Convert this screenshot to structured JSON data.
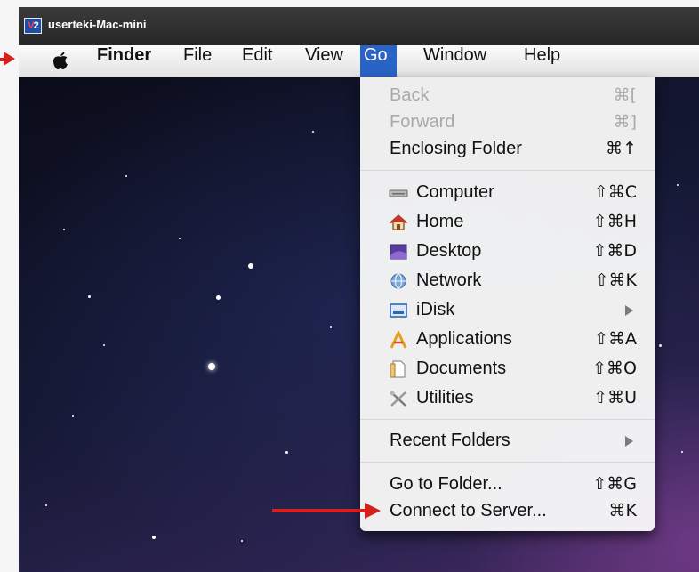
{
  "window": {
    "logo_text": "V2",
    "hostname": "userteki-Mac-mini"
  },
  "menubar": {
    "apple_icon": "apple-logo-icon",
    "items": [
      {
        "label": "Finder"
      },
      {
        "label": "File"
      },
      {
        "label": "Edit"
      },
      {
        "label": "View"
      },
      {
        "label": "Go"
      },
      {
        "label": "Window"
      },
      {
        "label": "Help"
      }
    ],
    "active": "Go",
    "active_color": "#2a63c6"
  },
  "go_menu": {
    "back": {
      "label": "Back",
      "shortcut": "⌘[",
      "enabled": false
    },
    "forward": {
      "label": "Forward",
      "shortcut": "⌘]",
      "enabled": false
    },
    "enclosing": {
      "label": "Enclosing Folder",
      "shortcut": "⌘↑",
      "enabled": true
    },
    "places": [
      {
        "label": "Computer",
        "shortcut": "⇧⌘C",
        "icon": "computer-icon"
      },
      {
        "label": "Home",
        "shortcut": "⇧⌘H",
        "icon": "home-icon"
      },
      {
        "label": "Desktop",
        "shortcut": "⇧⌘D",
        "icon": "desktop-icon"
      },
      {
        "label": "Network",
        "shortcut": "⇧⌘K",
        "icon": "network-icon"
      },
      {
        "label": "iDisk",
        "shortcut": "",
        "icon": "idisk-icon",
        "submenu": true
      },
      {
        "label": "Applications",
        "shortcut": "⇧⌘A",
        "icon": "applications-icon"
      },
      {
        "label": "Documents",
        "shortcut": "⇧⌘O",
        "icon": "documents-icon"
      },
      {
        "label": "Utilities",
        "shortcut": "⇧⌘U",
        "icon": "utilities-icon"
      }
    ],
    "recent": {
      "label": "Recent Folders",
      "submenu": true
    },
    "go_to_folder": {
      "label": "Go to Folder...",
      "shortcut": "⇧⌘G"
    },
    "connect": {
      "label": "Connect to Server...",
      "shortcut": "⌘K"
    }
  },
  "annotations": {
    "arrow_color": "#d6201e"
  }
}
